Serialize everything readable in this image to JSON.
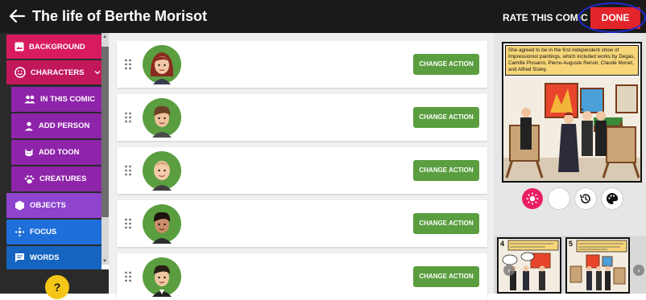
{
  "header": {
    "title": "The life of Berthe Morisot",
    "rate_label": "RATE THIS COMIC",
    "done_label": "DONE"
  },
  "colors": {
    "background": "#d81b60",
    "characters": "#c2185b",
    "sub": "#8e24aa",
    "objects": "#8e44ce",
    "focus": "#1e6fd9",
    "words": "#1565c0",
    "action_green": "#5a9e3f",
    "done_red": "#e3242b",
    "help_yellow": "#f5c518"
  },
  "sidebar": {
    "background_label": "BACKGROUND",
    "characters_label": "CHARACTERS",
    "in_this_comic_label": "IN THIS COMIC",
    "add_person_label": "ADD PERSON",
    "add_toon_label": "ADD TOON",
    "creatures_label": "CREATURES",
    "objects_label": "OBJECTS",
    "focus_label": "FOCUS",
    "words_label": "WORDS",
    "help_label": "?"
  },
  "characters": {
    "change_action_label": "CHANGE ACTION",
    "list": [
      {
        "icon": "woman-redhead-avatar"
      },
      {
        "icon": "man-brown-hair-avatar"
      },
      {
        "icon": "man-bald-avatar"
      },
      {
        "icon": "man-dark-hair-avatar"
      },
      {
        "icon": "man-dark-hair-suit-avatar"
      }
    ]
  },
  "preview": {
    "caption": "She agreed to be in the first independent show of Impressionist paintings, which included works by Degas, Camille Pissarro, Pierre-Auguste Renoir, Claude Monet, and Alfred Sisley."
  },
  "filmstrip": {
    "frames": [
      {
        "number": "4"
      },
      {
        "number": "5"
      }
    ]
  }
}
